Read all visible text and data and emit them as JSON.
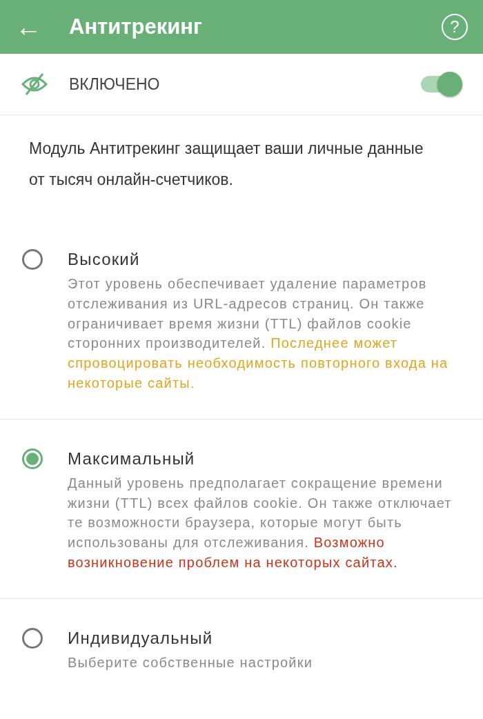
{
  "header": {
    "back": "←",
    "title": "Антитрекинг",
    "help": "?"
  },
  "master": {
    "label": "ВКЛЮЧЕНО",
    "on": true
  },
  "intro": "Модуль Антитрекинг защищает ваши личные данные от тысяч онлайн-счетчиков.",
  "options": [
    {
      "title": "Высокий",
      "description": "Этот уровень обеспечивает удаление параметров отслеживания из URL-адресов страниц. Он также ограничивает время жизни (TTL) файлов cookie сторонних производителей.",
      "warning": "Последнее может спровоцировать необходимость повторного входа на некоторые сайты.",
      "color": "#e2a51e",
      "selected": false
    },
    {
      "title": "Максимальный",
      "description": "Данный уровень предполагает сокращение времени жизни (TTL) всех файлов cookie. Он также отключает те возможности браузера, которые могут быть использованы для отслеживания.",
      "warning": "Возможно возникновение проблем на некоторых сайтах.",
      "color": "#c8341a",
      "selected": true
    },
    {
      "title": "Индивидуальный",
      "description": "Выберите собственные настройки",
      "selected": false
    }
  ]
}
